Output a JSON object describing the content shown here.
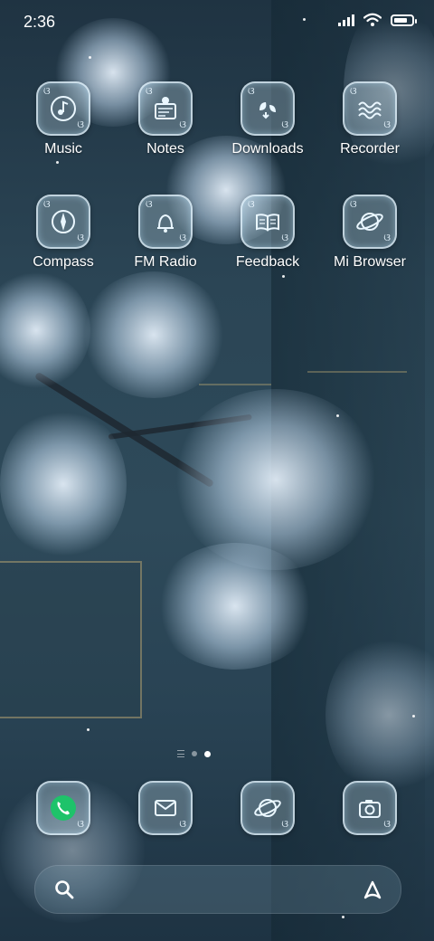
{
  "status_bar": {
    "time": "2:36",
    "battery_level": 0.76
  },
  "home": {
    "row1": [
      {
        "label": "Music",
        "icon": "music-note-icon"
      },
      {
        "label": "Notes",
        "icon": "notes-icon"
      },
      {
        "label": "Downloads",
        "icon": "download-icon"
      },
      {
        "label": "Recorder",
        "icon": "recorder-icon"
      }
    ],
    "row2": [
      {
        "label": "Compass",
        "icon": "compass-icon"
      },
      {
        "label": "FM Radio",
        "icon": "radio-bell-icon"
      },
      {
        "label": "Feedback",
        "icon": "feedback-book-icon"
      },
      {
        "label": "Mi Browser",
        "icon": "planet-browser-icon"
      }
    ]
  },
  "pager": {
    "pages": 2,
    "active_page": 2
  },
  "dock": [
    {
      "name": "phone",
      "icon": "phone-icon",
      "accent": "#1ec36a"
    },
    {
      "name": "messages",
      "icon": "envelope-icon"
    },
    {
      "name": "browser",
      "icon": "planet-icon"
    },
    {
      "name": "camera",
      "icon": "camera-icon"
    }
  ],
  "search_bar": {
    "left_icon": "search-icon",
    "right_icon": "assistant-icon"
  },
  "colors": {
    "tile_border": "#e6f5ff",
    "background": "#2b4555"
  }
}
